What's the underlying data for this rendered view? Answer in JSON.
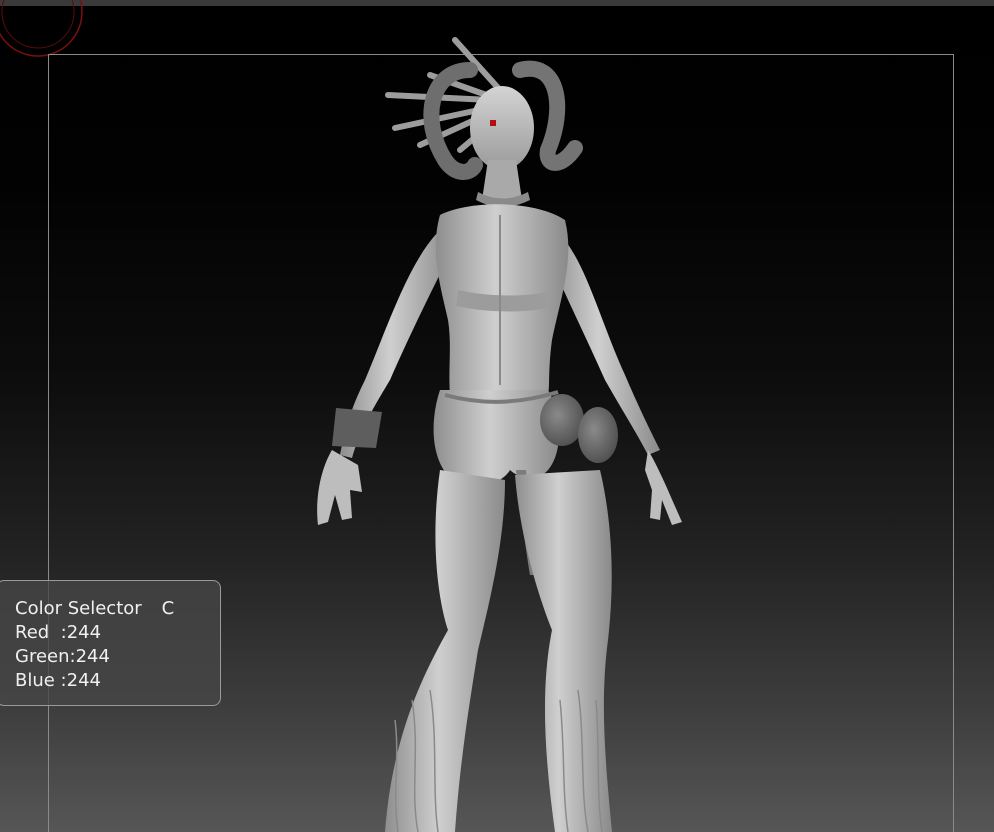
{
  "viewport": {
    "background_top": "#000000",
    "background_bottom": "#565656",
    "model_color": "#bdbdbd"
  },
  "color_selector": {
    "title": "Color Selector",
    "hotkey": "C",
    "red_label": "Red  :",
    "red_value": "244",
    "green_label": "Green:",
    "green_value": "244",
    "blue_label": "Blue :",
    "blue_value": "244"
  }
}
